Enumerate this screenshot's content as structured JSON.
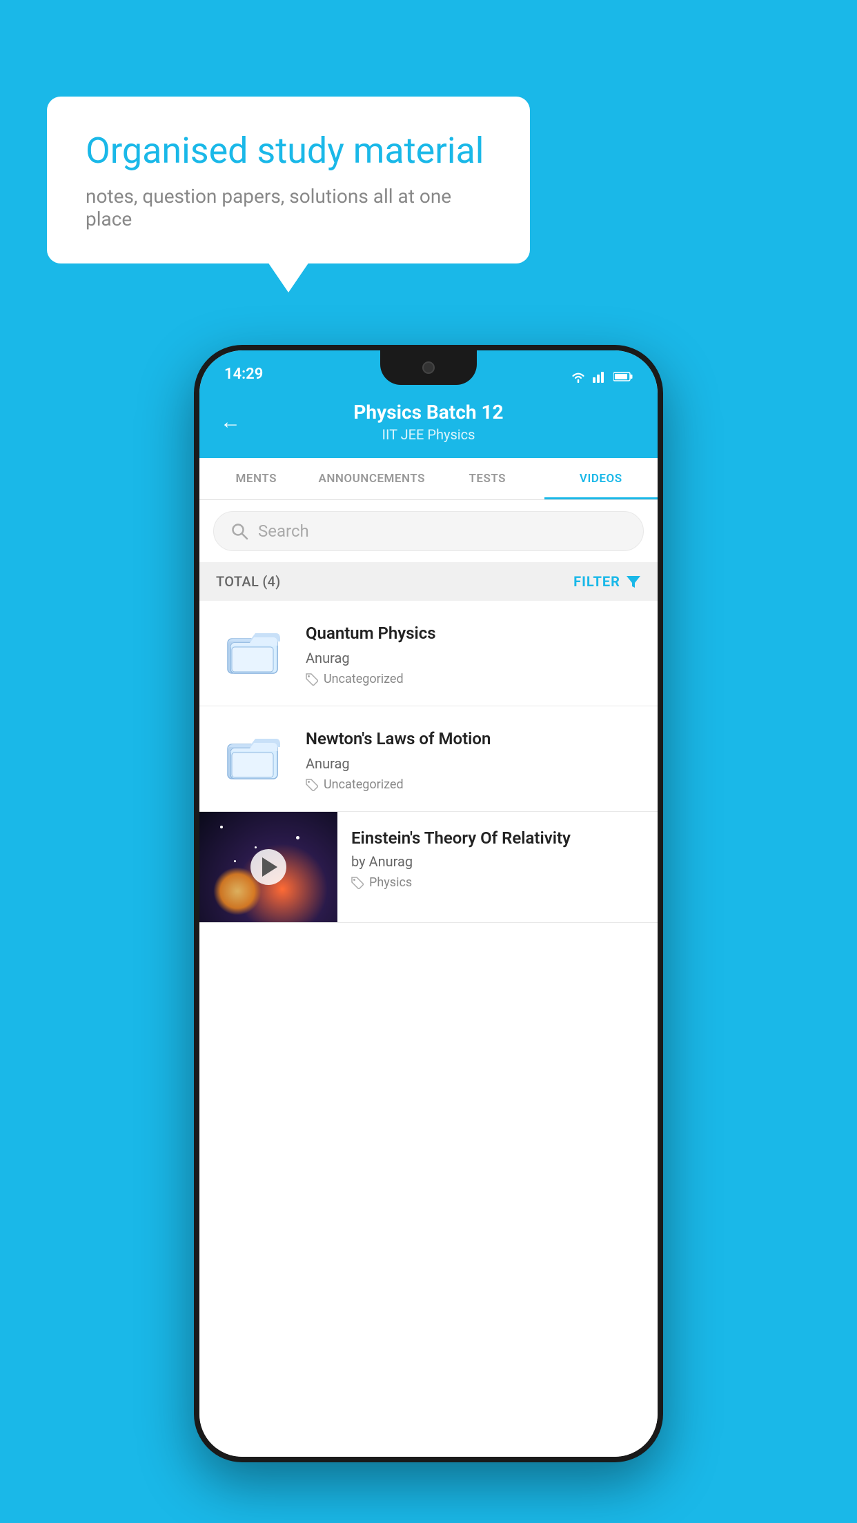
{
  "page": {
    "background_color": "#1ab8e8"
  },
  "speech_bubble": {
    "title": "Organised study material",
    "subtitle": "notes, question papers, solutions all at one place"
  },
  "phone": {
    "status_bar": {
      "time": "14:29",
      "icons": [
        "wifi",
        "signal",
        "battery"
      ]
    },
    "header": {
      "title": "Physics Batch 12",
      "subtitle": "IIT JEE   Physics",
      "back_label": "←"
    },
    "tabs": [
      {
        "label": "MENTS",
        "active": false
      },
      {
        "label": "ANNOUNCEMENTS",
        "active": false
      },
      {
        "label": "TESTS",
        "active": false
      },
      {
        "label": "VIDEOS",
        "active": true
      }
    ],
    "search": {
      "placeholder": "Search"
    },
    "filter_bar": {
      "total_label": "TOTAL (4)",
      "filter_label": "FILTER"
    },
    "videos": [
      {
        "title": "Quantum Physics",
        "author": "Anurag",
        "tag": "Uncategorized",
        "type": "folder"
      },
      {
        "title": "Newton's Laws of Motion",
        "author": "Anurag",
        "tag": "Uncategorized",
        "type": "folder"
      },
      {
        "title": "Einstein's Theory Of Relativity",
        "author": "by Anurag",
        "tag": "Physics",
        "type": "video"
      }
    ]
  }
}
